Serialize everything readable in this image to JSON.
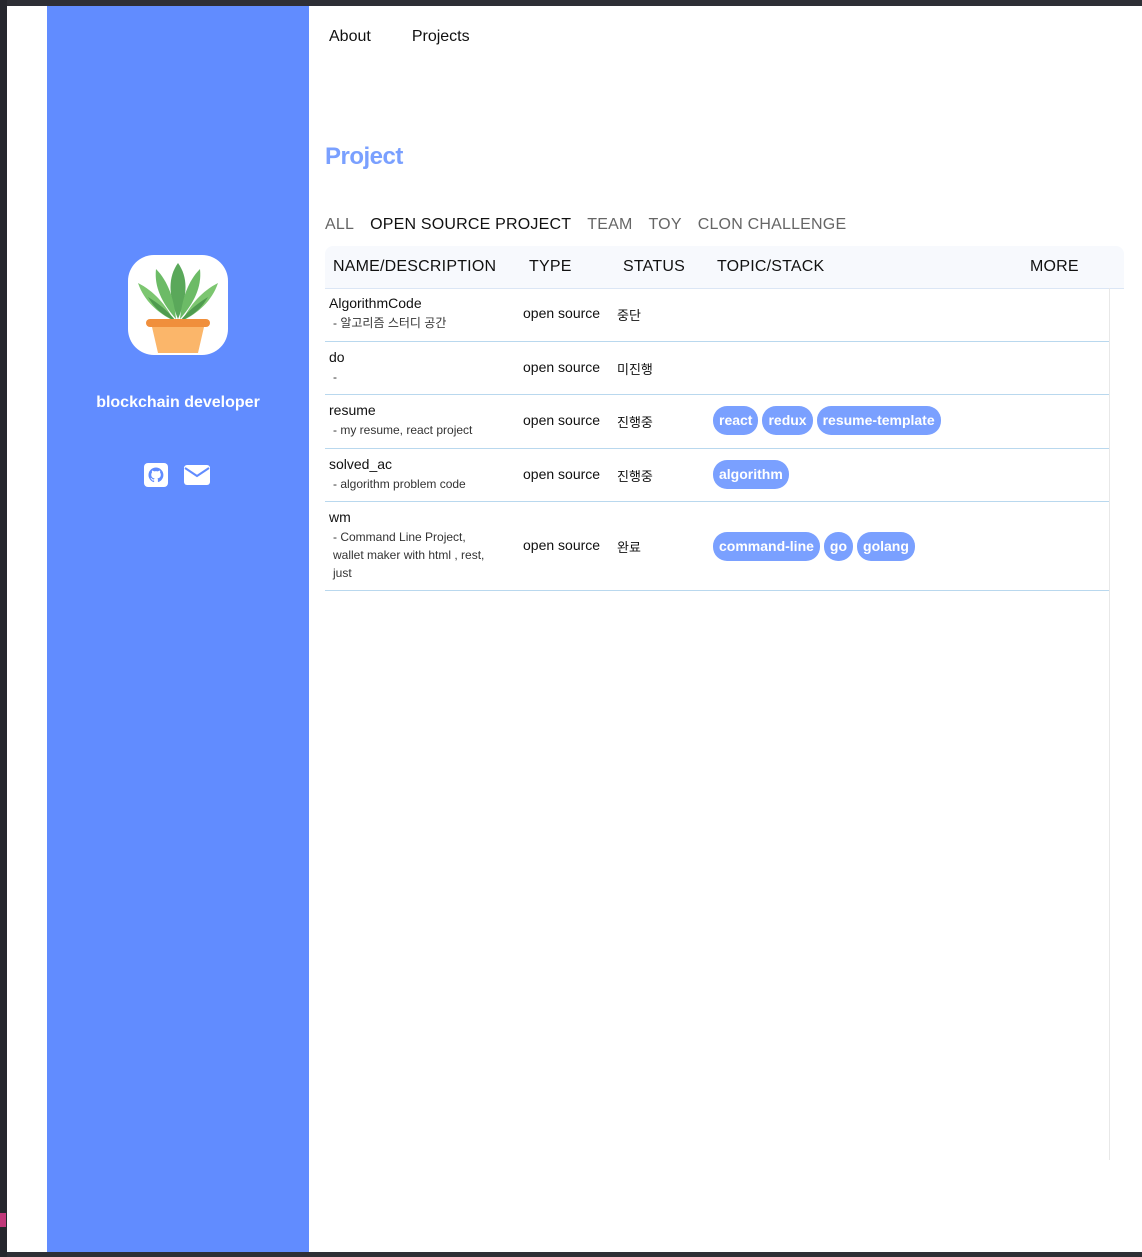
{
  "nav": {
    "about": "About",
    "projects": "Projects"
  },
  "sidebar": {
    "role": "blockchain developer"
  },
  "main": {
    "heading": "Project",
    "filters": [
      "ALL",
      "OPEN SOURCE PROJECT",
      "TEAM",
      "TOY",
      "CLON CHALLENGE"
    ],
    "active_filter": "OPEN SOURCE PROJECT",
    "columns": {
      "name": "NAME/DESCRIPTION",
      "type": "TYPE",
      "status": "STATUS",
      "topic": "TOPIC/STACK",
      "more": "MORE"
    },
    "rows": [
      {
        "name": "AlgorithmCode",
        "desc": "- 알고리즘 스터디 공간",
        "type": "open source",
        "status": "중단",
        "tags": []
      },
      {
        "name": "do",
        "desc": "-",
        "type": "open source",
        "status": "미진행",
        "tags": []
      },
      {
        "name": "resume",
        "desc": "- my resume, react project",
        "type": "open source",
        "status": "진행중",
        "tags": [
          "react",
          "redux",
          "resume-template"
        ]
      },
      {
        "name": "solved_ac",
        "desc": "- algorithm problem code",
        "type": "open source",
        "status": "진행중",
        "tags": [
          "algorithm"
        ]
      },
      {
        "name": "wm",
        "desc_lines": [
          "- Command Line Project,",
          "wallet maker with html , rest,",
          "just"
        ],
        "type": "open source",
        "status": "완료",
        "tags": [
          "command-line",
          "go",
          "golang"
        ]
      }
    ]
  },
  "colors": {
    "sidebar": "#618cff",
    "accent": "#7aa0ff",
    "row_border": "#b9d8ee"
  },
  "icons": {
    "avatar": "plant-pot-icon",
    "github": "github-icon",
    "mail": "mail-icon"
  }
}
